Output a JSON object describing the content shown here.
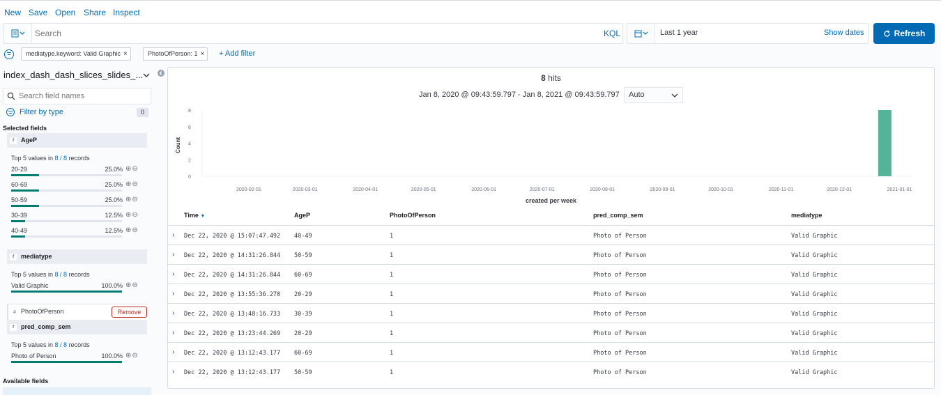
{
  "topnav": {
    "new": "New",
    "save": "Save",
    "open": "Open",
    "share": "Share",
    "inspect": "Inspect"
  },
  "query": {
    "placeholder": "Search",
    "language": "KQL"
  },
  "time": {
    "range": "Last 1 year",
    "show_dates": "Show dates",
    "refresh": "Refresh"
  },
  "filters": [
    "mediatype.keyword: Valid Graphic",
    "PhotoOfPerson: 1"
  ],
  "add_filter": "+ Add filter",
  "sidebar": {
    "index_pattern": "index_dash_dash_slices_slides_...",
    "field_search_placeholder": "Search field names",
    "filter_by_type": "Filter by type",
    "filter_count": "0",
    "selected_heading": "Selected fields",
    "available_heading": "Available fields",
    "fields": [
      {
        "name": "AgeP",
        "type": "t",
        "summary_prefix": "Top 5 values in ",
        "summary_count": "8 / 8",
        "summary_suffix": " records",
        "values": [
          {
            "label": "20-29",
            "pct": "25.0%",
            "fraction": 0.25
          },
          {
            "label": "60-69",
            "pct": "25.0%",
            "fraction": 0.25
          },
          {
            "label": "50-59",
            "pct": "25.0%",
            "fraction": 0.25
          },
          {
            "label": "30-39",
            "pct": "12.5%",
            "fraction": 0.125
          },
          {
            "label": "40-49",
            "pct": "12.5%",
            "fraction": 0.125
          }
        ]
      },
      {
        "name": "mediatype",
        "type": "t",
        "summary_prefix": "Top 5 values in ",
        "summary_count": "8 / 8",
        "summary_suffix": " records",
        "values": [
          {
            "label": "Valid Graphic",
            "pct": "100.0%",
            "fraction": 1.0
          }
        ]
      },
      {
        "name": "PhotoOfPerson",
        "type": "#",
        "action": "Remove"
      },
      {
        "name": "pred_comp_sem",
        "type": "t",
        "summary_prefix": "Top 5 values in ",
        "summary_count": "8 / 8",
        "summary_suffix": " records",
        "values": [
          {
            "label": "Photo of Person",
            "pct": "100.0%",
            "fraction": 1.0
          }
        ]
      }
    ]
  },
  "results": {
    "hits": "8",
    "hits_label": "hits",
    "date_range": "Jan 8, 2020 @ 09:43:59.797 - Jan 8, 2021 @ 09:43:59.797",
    "interval": "Auto",
    "columns": [
      "Time",
      "AgeP",
      "PhotoOfPerson",
      "pred_comp_sem",
      "mediatype"
    ],
    "rows": [
      [
        "Dec 22, 2020 @ 15:07:47.492",
        "40-49",
        "1",
        "Photo of Person",
        "Valid Graphic"
      ],
      [
        "Dec 22, 2020 @ 14:31:26.844",
        "50-59",
        "1",
        "Photo of Person",
        "Valid Graphic"
      ],
      [
        "Dec 22, 2020 @ 14:31:26.844",
        "60-69",
        "1",
        "Photo of Person",
        "Valid Graphic"
      ],
      [
        "Dec 22, 2020 @ 13:55:36.270",
        "20-29",
        "1",
        "Photo of Person",
        "Valid Graphic"
      ],
      [
        "Dec 22, 2020 @ 13:48:16.733",
        "30-39",
        "1",
        "Photo of Person",
        "Valid Graphic"
      ],
      [
        "Dec 22, 2020 @ 13:23:44.269",
        "20-29",
        "1",
        "Photo of Person",
        "Valid Graphic"
      ],
      [
        "Dec 22, 2020 @ 13:12:43.177",
        "60-69",
        "1",
        "Photo of Person",
        "Valid Graphic"
      ],
      [
        "Dec 22, 2020 @ 13:12:43.177",
        "50-59",
        "1",
        "Photo of Person",
        "Valid Graphic"
      ]
    ]
  },
  "chart_data": {
    "type": "bar",
    "xlabel": "created per week",
    "ylabel": "Count",
    "ylim": [
      0,
      8
    ],
    "yticks": [
      0,
      2,
      4,
      6,
      8
    ],
    "xticks": [
      "2020-02-01",
      "2020-03-01",
      "2020-04-01",
      "2020-05-01",
      "2020-06-01",
      "2020-07-01",
      "2020-08-01",
      "2020-09-01",
      "2020-10-01",
      "2020-11-01",
      "2020-12-01",
      "2021-01-01"
    ],
    "x": [
      "2020-12-21"
    ],
    "values": [
      8
    ],
    "color": "#54b399"
  },
  "colors": {
    "accent": "#006bb4",
    "bar": "#54b399",
    "value_bar": "#017d73"
  }
}
